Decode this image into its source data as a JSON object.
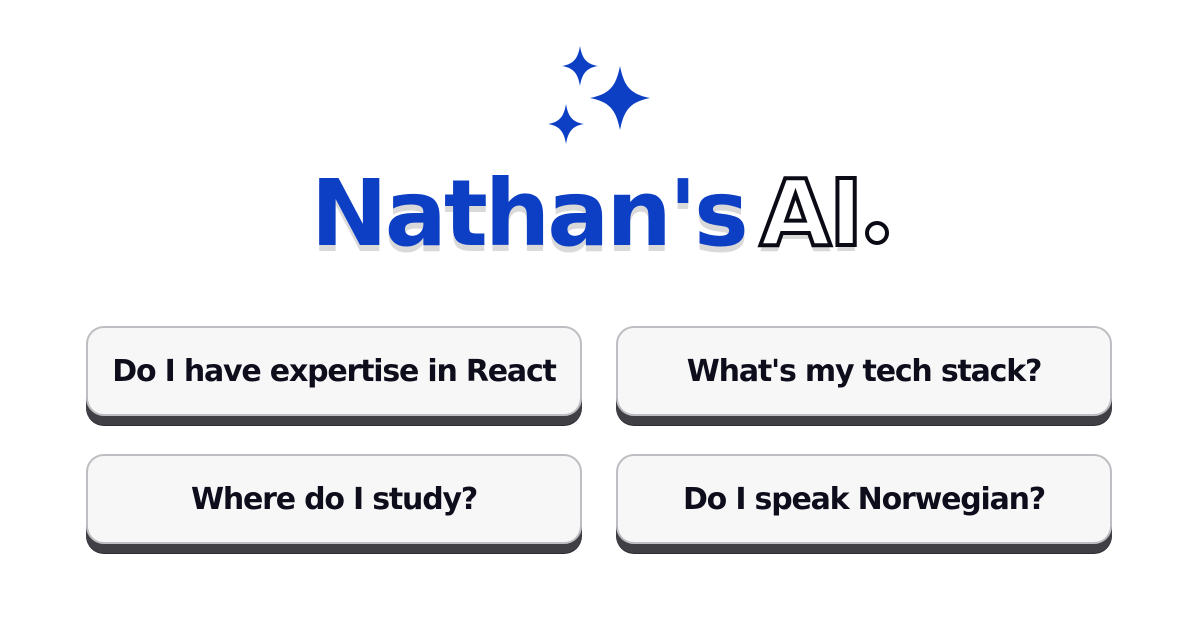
{
  "header": {
    "icon": "sparkles-icon",
    "title_name": "Nathan's",
    "title_ai": "AI",
    "accent_color": "#0d3fc4"
  },
  "suggestions": [
    {
      "label": "Do I have expertise in React"
    },
    {
      "label": "What's my tech stack?"
    },
    {
      "label": "Where do I study?"
    },
    {
      "label": "Do I speak Norwegian?"
    }
  ]
}
